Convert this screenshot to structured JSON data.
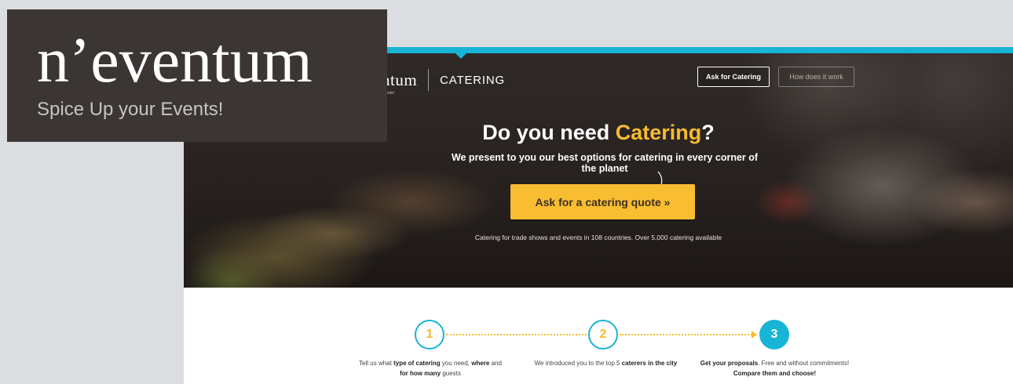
{
  "logo_popup": {
    "name": "n’eventum",
    "tagline": "Spice Up your Events!"
  },
  "header": {
    "brand_name": "ntum",
    "brand_tag": "events!",
    "section": "CATERING",
    "nav": {
      "ask_label": "Ask for Catering",
      "how_label": "How does it work"
    }
  },
  "hero": {
    "title_prefix": "Do you need ",
    "title_accent": "Catering",
    "title_suffix": "?",
    "subtitle": "We present to you our best options for catering in every corner of the planet",
    "cta_label": "Ask for a catering quote »",
    "note": "Catering for trade shows and events in 108 countries. Over 5,000 catering available"
  },
  "steps": [
    {
      "number": "1",
      "pre": "Tell us what ",
      "b1": "type of catering",
      "mid1": " you need, ",
      "b2": "where",
      "mid2": " and ",
      "b3": "for how many",
      "post": " guests"
    },
    {
      "number": "2",
      "pre": "We introduced you to the top 5 ",
      "b1": "caterers in the city"
    },
    {
      "number": "3",
      "b1": "Get your proposals",
      "mid1": ". Free and without commitments! ",
      "b2": "Compare them and choose!"
    }
  ],
  "colors": {
    "accent_blue": "#18b4d6",
    "accent_yellow": "#f8bb30"
  }
}
